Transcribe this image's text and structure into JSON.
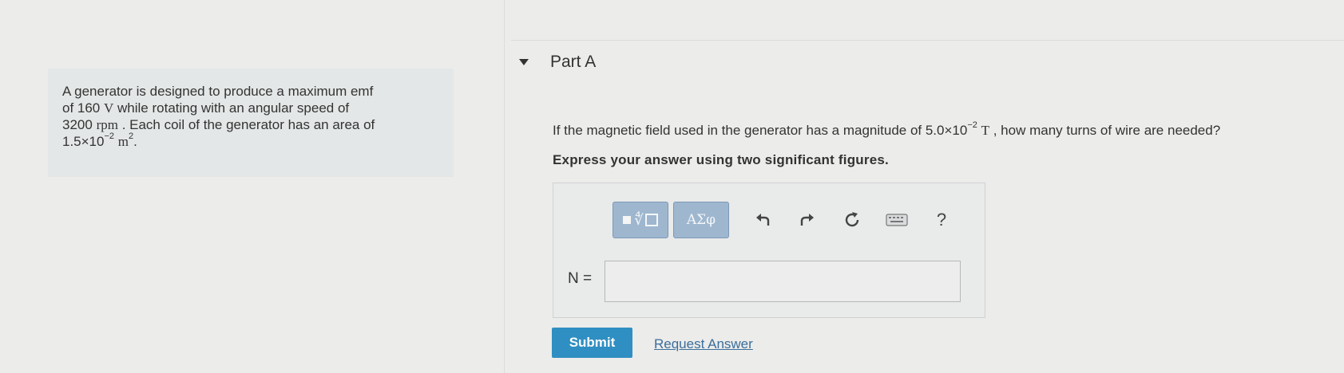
{
  "problem": {
    "line1": "A generator is designed to produce a maximum emf",
    "line2_pre": "of 160",
    "line2_unit": "V",
    "line2_post": "while rotating with an angular speed of",
    "line3_pre": "3200",
    "line3_unit": "rpm",
    "line3_post": ". Each coil of the generator has an area of",
    "line4_base": "1.5×10",
    "line4_exp": "−2",
    "line4_unit": "m",
    "line4_unit_exp": "2",
    "line4_post": "."
  },
  "part": {
    "title": "Part A",
    "question_pre": "If the magnetic field used in the generator has a magnitude of 5.0×10",
    "question_exp": "−2",
    "question_unit": "T",
    "question_post": ", how many turns of wire are needed?",
    "instruction": "Express your answer using two significant figures."
  },
  "toolbar": {
    "symbols_label": "ΑΣφ",
    "help_label": "?",
    "icons": [
      "templates-icon",
      "undo-icon",
      "redo-icon",
      "reset-icon",
      "keyboard-icon",
      "help-icon"
    ]
  },
  "answer": {
    "variable": "N =",
    "value": ""
  },
  "actions": {
    "submit_label": "Submit",
    "request_label": "Request Answer"
  },
  "colors": {
    "submit": "#2f8fc2",
    "toolbar_button": "#9eb7cf",
    "link": "#3b6e9c"
  }
}
